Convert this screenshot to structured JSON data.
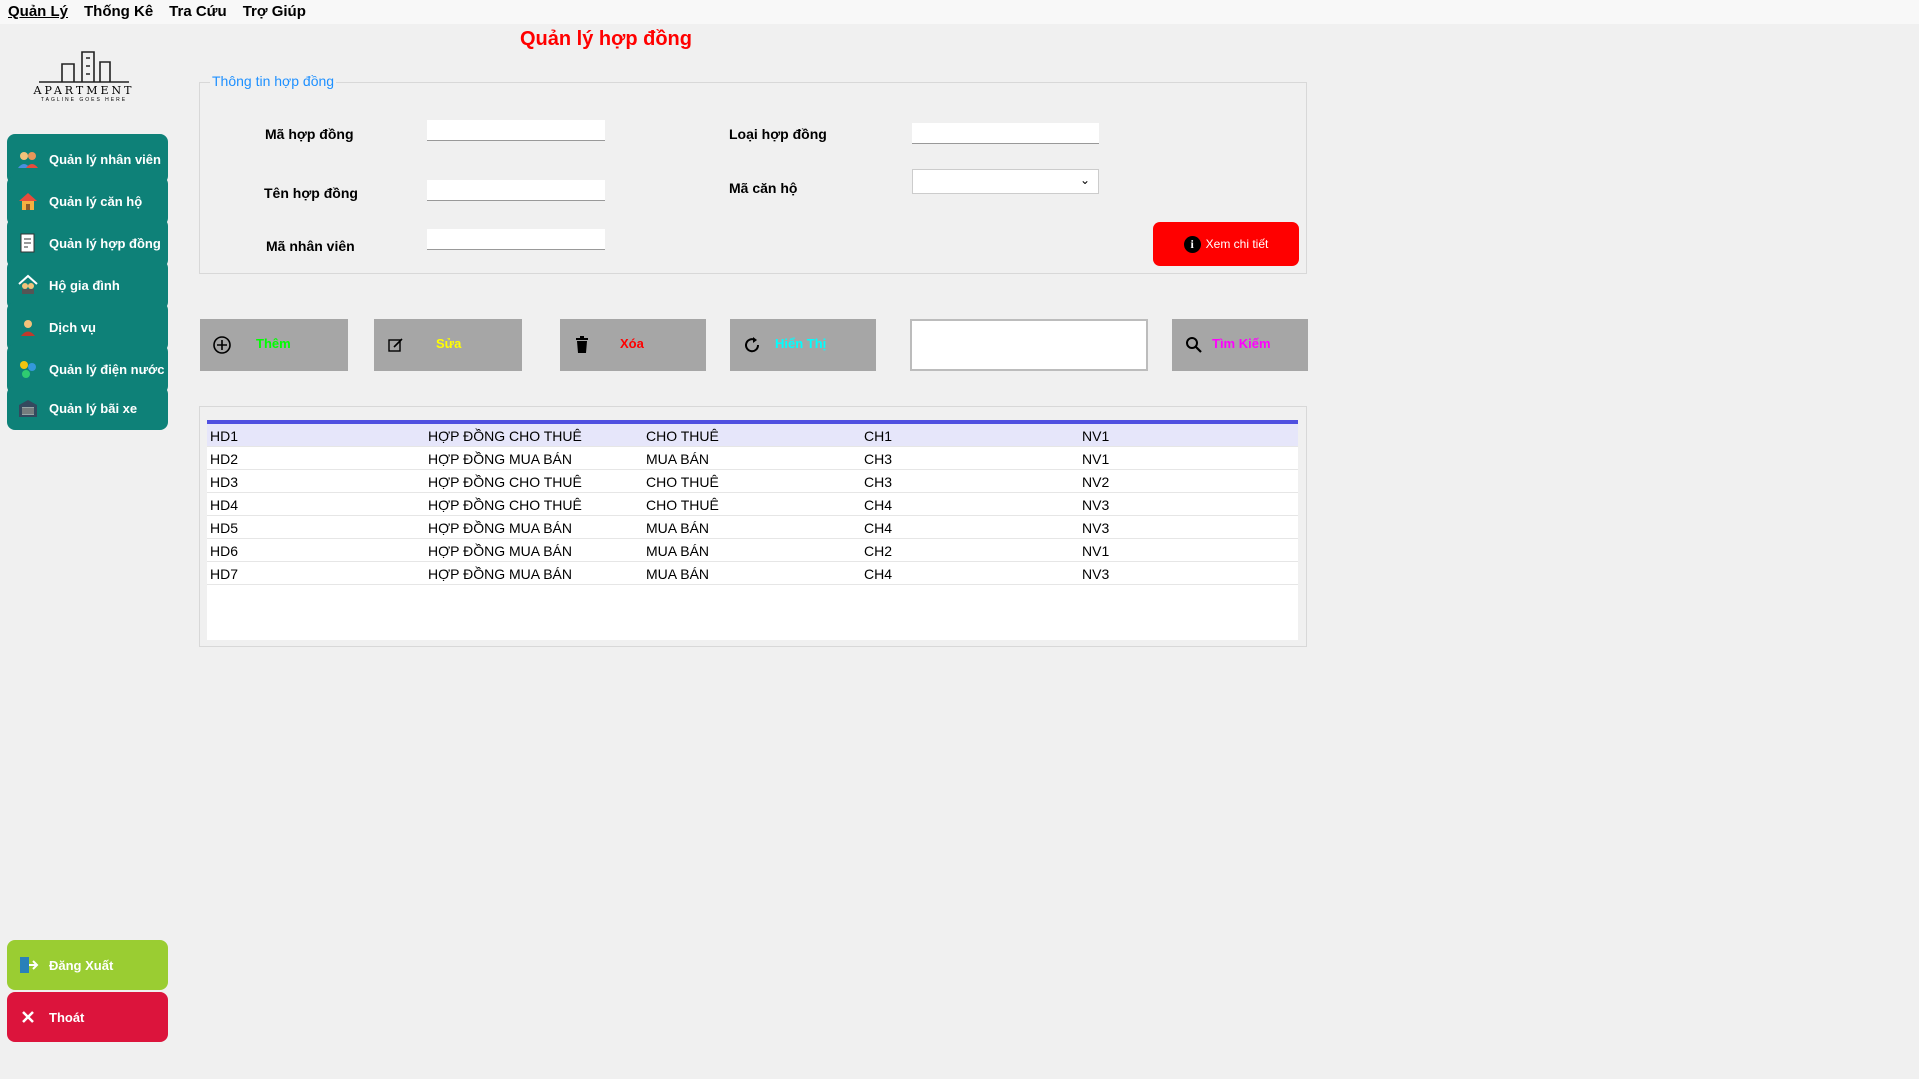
{
  "menu": [
    "Quản Lý",
    "Thống Kê",
    "Tra Cứu",
    "Trợ Giúp"
  ],
  "logo": {
    "name": "APARTMENT",
    "tagline": "TAGLINE GOES HERE"
  },
  "sidebar": {
    "items": [
      {
        "label": "Quản lý nhân viên",
        "icon": "people-icon"
      },
      {
        "label": "Quản lý căn hộ",
        "icon": "house-icon"
      },
      {
        "label": "Quản lý hợp đồng",
        "icon": "document-icon"
      },
      {
        "label": "Hộ gia đình",
        "icon": "family-icon"
      },
      {
        "label": "Dịch vụ",
        "icon": "service-icon"
      },
      {
        "label": "Quản lý điện nước",
        "icon": "utility-icon"
      },
      {
        "label": "Quản lý bãi xe",
        "icon": "garage-icon"
      }
    ],
    "logout": "Đăng Xuất",
    "exit": "Thoát"
  },
  "page": {
    "title": "Quản lý hợp đồng"
  },
  "form": {
    "group_title": "Thông tin hợp đồng",
    "ma_hop_dong": {
      "label": "Mã hợp đồng",
      "value": ""
    },
    "ten_hop_dong": {
      "label": "Tên hợp đồng",
      "value": ""
    },
    "ma_nhan_vien": {
      "label": "Mã nhân viên",
      "value": ""
    },
    "loai_hop_dong": {
      "label": "Loại hợp đồng",
      "value": ""
    },
    "ma_can_ho": {
      "label": "Mã căn hộ",
      "value": ""
    },
    "detail_button": "Xem chi tiết"
  },
  "actions": {
    "add": "Thêm",
    "edit": "Sửa",
    "delete": "Xóa",
    "show": "Hiển Thị",
    "search_value": "",
    "search": "Tìm Kiếm"
  },
  "colors": {
    "accent_teal": "#0e8178",
    "title_red": "#ff0000",
    "add_text": "#00ff00",
    "edit_text": "#ffff00",
    "delete_text": "#ff0000",
    "show_text": "#00ffff",
    "search_text": "#ff00ff"
  },
  "table": {
    "rows": [
      [
        "HD1",
        "HỢP ĐỒNG CHO THUÊ",
        "CHO THUÊ",
        "CH1",
        "NV1"
      ],
      [
        "HD2",
        "HỢP ĐỒNG MUA BÁN",
        "MUA BÁN",
        "CH3",
        "NV1"
      ],
      [
        "HD3",
        "HỢP ĐỒNG CHO THUÊ",
        "CHO THUÊ",
        "CH3",
        "NV2"
      ],
      [
        "HD4",
        "HỢP ĐỒNG CHO THUÊ",
        "CHO THUÊ",
        "CH4",
        "NV3"
      ],
      [
        "HD5",
        "HỢP ĐỒNG MUA BÁN",
        "MUA BÁN",
        "CH4",
        "NV3"
      ],
      [
        "HD6",
        "HỢP ĐỒNG MUA BÁN",
        "MUA BÁN",
        "CH2",
        "NV1"
      ],
      [
        "HD7",
        "HỢP ĐỒNG MUA BÁN",
        "MUA BÁN",
        "CH4",
        "NV3"
      ]
    ]
  }
}
